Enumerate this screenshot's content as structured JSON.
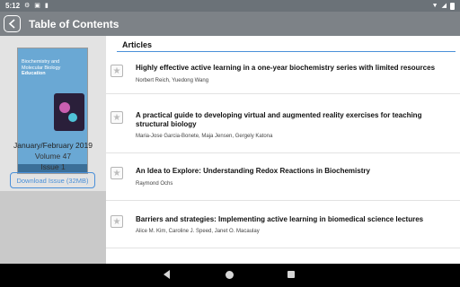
{
  "status_bar": {
    "time": "5:12",
    "icons": [
      "gear-icon",
      "alert-icon",
      "sim-icon",
      "wifi-icon",
      "signal-icon",
      "battery-icon"
    ]
  },
  "app_bar": {
    "title": "Table of Contents",
    "back_icon": "chevron-left-icon"
  },
  "issue": {
    "cover": {
      "title_line1": "Biochemistry and",
      "title_line2": "Molecular Biology",
      "title_line3": "Education"
    },
    "date": "January/February 2019",
    "volume": "Volume 47",
    "issue": "Issue 1",
    "download_label": "Download Issue (32MB)"
  },
  "articles": {
    "header": "Articles",
    "items": [
      {
        "title": "Highly effective active learning in a one-year biochemistry series with limited resources",
        "authors": "Norbert Reich, Yuedong Wang"
      },
      {
        "title": "A practical guide to developing virtual and augmented reality exercises for teaching structural biology",
        "authors": "Maria-Jose Garcia-Bonete, Maja Jensen, Gergely Katona"
      },
      {
        "title": "An Idea to Explore: Understanding Redox Reactions in Biochemistry",
        "authors": "Raymond Ochs"
      },
      {
        "title": "Barriers and strategies: Implementing active learning in biomedical science lectures",
        "authors": "Alice M. Kim, Caroline J. Speed, Janet O. Macaulay"
      }
    ]
  },
  "colors": {
    "app_bar": "#7d8287",
    "accent": "#4a90d9",
    "left_panel": "#c9c9c9"
  }
}
